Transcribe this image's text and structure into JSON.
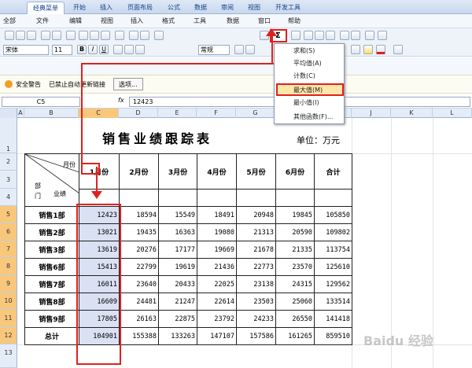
{
  "ribbon_tabs": [
    "经典菜单",
    "开始",
    "插入",
    "页面布局",
    "公式",
    "数据",
    "审阅",
    "视图",
    "开发工具"
  ],
  "menubar": [
    "全部",
    "文件",
    "编辑",
    "视图",
    "插入",
    "格式",
    "工具",
    "数据",
    "窗口",
    "帮助"
  ],
  "font": {
    "name": "宋体",
    "size": "11",
    "style": "常规"
  },
  "autosum_symbol": "Σ",
  "autosum_menu": [
    {
      "label": "求和(S)",
      "highlighted": false
    },
    {
      "label": "平均值(A)",
      "highlighted": false
    },
    {
      "label": "计数(C)",
      "highlighted": false
    },
    {
      "label": "最大值(M)",
      "highlighted": true
    },
    {
      "label": "最小值(I)",
      "highlighted": false
    },
    {
      "label": "其他函数(F)...",
      "highlighted": false
    }
  ],
  "security": {
    "title": "安全警告",
    "message": "已禁止自动更新链接",
    "button": "选项..."
  },
  "formula_bar": {
    "name_box": "C5",
    "fx": "fx",
    "content": "12423"
  },
  "columns": [
    "A",
    "B",
    "C",
    "D",
    "E",
    "F",
    "G",
    "H",
    "I",
    "J",
    "K",
    "L"
  ],
  "rows": [
    "1",
    "2",
    "3",
    "4",
    "5",
    "6",
    "7",
    "8",
    "9",
    "10",
    "11",
    "12",
    "13"
  ],
  "sheet": {
    "title": "销售业绩跟踪表",
    "unit": "单位：万元",
    "header_month": "月份",
    "header_dept_1": "部",
    "header_dept_2": "门",
    "header_perf": "业绩",
    "months": [
      "1月份",
      "2月份",
      "3月份",
      "4月份",
      "5月份",
      "6月份",
      "合计"
    ],
    "data": [
      {
        "dept": "销售1部",
        "values": [
          "12423",
          "18594",
          "15549",
          "18491",
          "20948",
          "19845",
          "105850"
        ]
      },
      {
        "dept": "销售2部",
        "values": [
          "13021",
          "19435",
          "16363",
          "19080",
          "21313",
          "20590",
          "109802"
        ]
      },
      {
        "dept": "销售3部",
        "values": [
          "13619",
          "20276",
          "17177",
          "19669",
          "21678",
          "21335",
          "113754"
        ]
      },
      {
        "dept": "销售6部",
        "values": [
          "15413",
          "22799",
          "19619",
          "21436",
          "22773",
          "23570",
          "125610"
        ]
      },
      {
        "dept": "销售7部",
        "values": [
          "16011",
          "23640",
          "20433",
          "22025",
          "23138",
          "24315",
          "129562"
        ]
      },
      {
        "dept": "销售8部",
        "values": [
          "16609",
          "24481",
          "21247",
          "22614",
          "23503",
          "25060",
          "133514"
        ]
      },
      {
        "dept": "销售9部",
        "values": [
          "17805",
          "26163",
          "22875",
          "23792",
          "24233",
          "26550",
          "141418"
        ]
      },
      {
        "dept": "总计",
        "values": [
          "104901",
          "155388",
          "133263",
          "147107",
          "157586",
          "161265",
          "859510"
        ]
      }
    ]
  },
  "watermark": "Baidu 经验"
}
